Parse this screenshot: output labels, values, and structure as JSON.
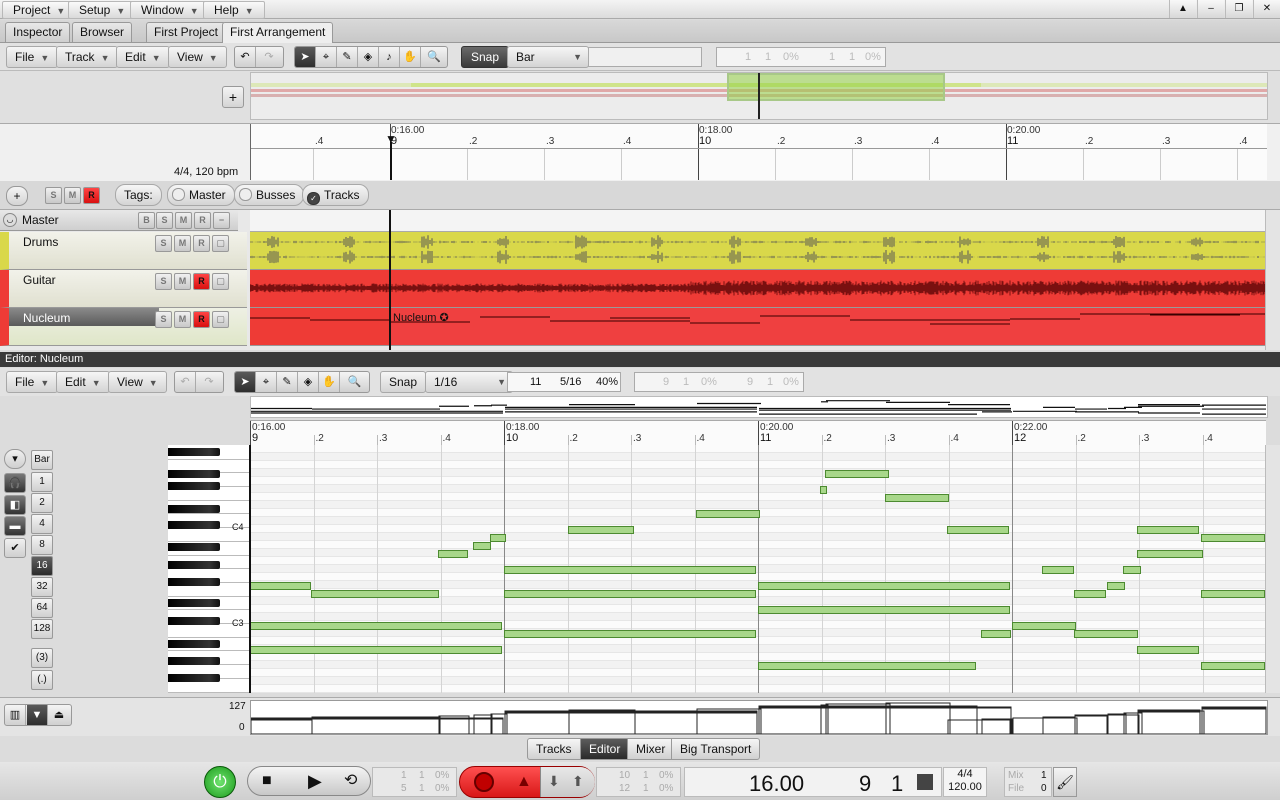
{
  "menubar": {
    "items": [
      "Project",
      "Setup",
      "Window",
      "Help"
    ]
  },
  "tabs": {
    "inspector": "Inspector",
    "browser": "Browser",
    "project": "First Project",
    "arrangement": "First Arrangement"
  },
  "arr_toolbar": {
    "file": "File",
    "track": "Track",
    "edit": "Edit",
    "view": "View",
    "snap": "Snap",
    "snap_value": "Bar",
    "pos1": "1",
    "pos2": "1",
    "pos3": "0%",
    "pos4": "1",
    "pos5": "1",
    "pos6": "0%"
  },
  "arr_ruler": {
    "time_labels": [
      "0:16.00",
      "0:18.00",
      "0:20.00"
    ],
    "bars": [
      "9",
      "10",
      "11"
    ],
    "beats": [
      ".4",
      ".2",
      ".3",
      ".4",
      ".2",
      ".3",
      ".4",
      ".2",
      ".3",
      ".4"
    ],
    "meter": "4/4, 120 bpm"
  },
  "tags_bar": {
    "s": "S",
    "m": "M",
    "r": "R",
    "tags_label": "Tags:",
    "master": "Master",
    "busses": "Busses",
    "tracks": "Tracks"
  },
  "tracks": [
    {
      "name": "Master",
      "buttons": [
        "B",
        "S",
        "M",
        "R",
        "−"
      ]
    },
    {
      "name": "Drums",
      "buttons": [
        "S",
        "M",
        "R"
      ],
      "color": "#d9d84a"
    },
    {
      "name": "Guitar",
      "buttons": [
        "S",
        "M",
        "R"
      ],
      "color": "#ee3b36"
    },
    {
      "name": "Nucleum",
      "buttons": [
        "S",
        "M",
        "R"
      ],
      "color": "#ee3b36",
      "clip_label": "Nucleum"
    }
  ],
  "editor": {
    "title": "Editor: Nucleum",
    "file": "File",
    "edit": "Edit",
    "view": "View",
    "snap": "Snap",
    "snap_value": "1/16",
    "pos_bar": "11",
    "pos_beat": "5/16",
    "pos_pct": "40%",
    "ghost": [
      "9",
      "1",
      "0%",
      "9",
      "1",
      "0%"
    ],
    "time_labels": [
      "0:16.00",
      "0:18.00",
      "0:20.00",
      "0:22.00"
    ],
    "bars": [
      "9",
      "10",
      "11",
      "12"
    ],
    "beats": [
      ".2",
      ".3",
      ".4",
      ".2",
      ".3",
      ".4",
      ".2",
      ".3",
      ".4",
      ".2",
      ".3",
      ".4"
    ],
    "key_labels": [
      "C4",
      "C3"
    ],
    "quantize": [
      "Bar",
      "1",
      "2",
      "4",
      "8",
      "16",
      "32",
      "64",
      "128",
      "(3)",
      "(.)"
    ],
    "quantize_selected": "16",
    "velocity_max": "127",
    "velocity_min": "0"
  },
  "bottom_tabs": [
    "Tracks",
    "Editor",
    "Mixer",
    "Big Transport"
  ],
  "transport": {
    "time": "16.00",
    "bar": "9",
    "beat": "1",
    "meter": "4/4",
    "tempo": "120.00",
    "left_pos": [
      "1",
      "1",
      "0%",
      "5",
      "1",
      "0%"
    ],
    "right_pos": [
      "10",
      "1",
      "0%",
      "12",
      "1",
      "0%"
    ],
    "mix_label": "Mix",
    "mix_val": "1",
    "file_label": "File",
    "file_val": "0"
  },
  "colors": {
    "drums": "#d9d84a",
    "guitar": "#ee3b36",
    "note": "#a8d78a",
    "record": "#e02020"
  }
}
